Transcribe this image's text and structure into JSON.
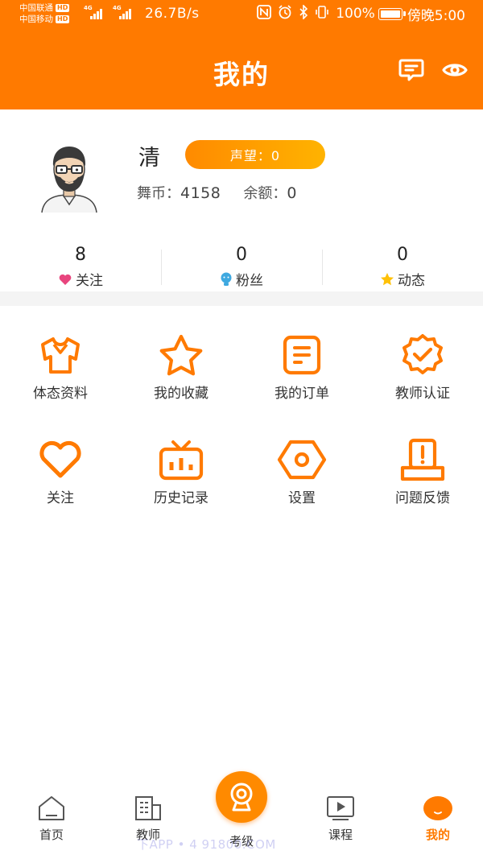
{
  "status_bar": {
    "carrier_1": "中国联通",
    "carrier_2": "中国移动",
    "hd_1": "HD",
    "hd_2": "HD",
    "network_1": "4G",
    "network_2": "4G",
    "net_speed": "26.7B/s",
    "battery": "100%",
    "time": "傍晚5:00"
  },
  "header": {
    "title": "我的",
    "message_icon": "message-icon",
    "settings_icon": "eye-settings-icon"
  },
  "profile": {
    "username": "清",
    "reputation": "声望：0",
    "coins_label": "舞币：",
    "coins_value": "4158",
    "balance_label": "余额：",
    "balance_value": "0"
  },
  "stats": [
    {
      "count": "8",
      "label": "关注",
      "icon": "heart-icon"
    },
    {
      "count": "0",
      "label": "粉丝",
      "icon": "fan-icon"
    },
    {
      "count": "0",
      "label": "动态",
      "icon": "star-icon"
    }
  ],
  "features": [
    {
      "label": "体态资料",
      "icon": "shirt-icon"
    },
    {
      "label": "我的收藏",
      "icon": "star-outline-icon"
    },
    {
      "label": "我的订单",
      "icon": "order-icon"
    },
    {
      "label": "教师认证",
      "icon": "certificate-icon"
    },
    {
      "label": "关注",
      "icon": "heart-outline-icon"
    },
    {
      "label": "历史记录",
      "icon": "tv-history-icon"
    },
    {
      "label": "设置",
      "icon": "hexagon-settings-icon"
    },
    {
      "label": "问题反馈",
      "icon": "feedback-icon"
    }
  ],
  "tabbar": [
    {
      "label": "首页",
      "icon": "home-icon"
    },
    {
      "label": "教师",
      "icon": "building-icon"
    },
    {
      "label": "考级",
      "icon": "exam-icon"
    },
    {
      "label": "课程",
      "icon": "video-icon"
    },
    {
      "label": "我的",
      "icon": "profile-icon"
    }
  ],
  "watermark": "下APP • 4      91800.COM",
  "colors": {
    "accent": "#FF7A00",
    "reputation_gradient_start": "#FF8A00",
    "reputation_gradient_end": "#FFB300",
    "heart": "#E8457E",
    "fan": "#3FA9E0",
    "star": "#FFC107"
  }
}
